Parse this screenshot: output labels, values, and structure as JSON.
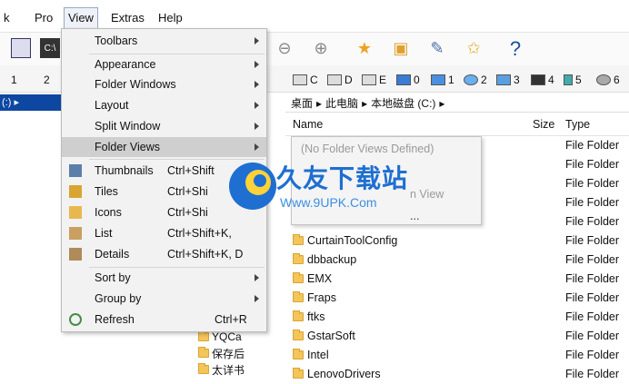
{
  "menubar": {
    "items": [
      "k",
      "Pro",
      "View",
      "Extras",
      "Help"
    ]
  },
  "drives": [
    "1",
    "2",
    "C",
    "D",
    "E",
    "0",
    "1",
    "2",
    "3",
    "4",
    "5",
    "6"
  ],
  "left_pane": {
    "selected_label": "(:) ▸"
  },
  "addressbar": {
    "path": [
      "桌面",
      "此电脑",
      "本地磁盘 (C:)"
    ]
  },
  "columns": {
    "name": "Name",
    "size": "Size",
    "type": "Type"
  },
  "files": [
    {
      "name": "",
      "type": "File Folder"
    },
    {
      "name": "",
      "type": "File Folder"
    },
    {
      "name": "",
      "type": "File Folder"
    },
    {
      "name": "",
      "type": "File Folder"
    },
    {
      "name": "",
      "type": "File Folder"
    },
    {
      "name": "CurtainToolConfig",
      "type": "File Folder"
    },
    {
      "name": "dbbackup",
      "type": "File Folder"
    },
    {
      "name": "EMX",
      "type": "File Folder"
    },
    {
      "name": "Fraps",
      "type": "File Folder"
    },
    {
      "name": "ftks",
      "type": "File Folder"
    },
    {
      "name": "GstarSoft",
      "type": "File Folder"
    },
    {
      "name": "Intel",
      "type": "File Folder"
    },
    {
      "name": "LenovoDrivers",
      "type": "File Folder"
    }
  ],
  "tree": [
    "YQCa",
    "保存后",
    "太详书"
  ],
  "view_menu": {
    "toolbars": "Toolbars",
    "appearance": "Appearance",
    "folder_windows": "Folder Windows",
    "layout": "Layout",
    "split_window": "Split Window",
    "folder_views": "Folder Views",
    "thumbnails": "Thumbnails",
    "thumbnails_sc": "Ctrl+Shift",
    "tiles": "Tiles",
    "tiles_sc": "Ctrl+Shi",
    "icons": "Icons",
    "icons_sc": "Ctrl+Shi",
    "list": "List",
    "list_sc": "Ctrl+Shift+K, ",
    "details": "Details",
    "details_sc": "Ctrl+Shift+K, D",
    "sort_by": "Sort by",
    "group_by": "Group by",
    "refresh": "Refresh",
    "refresh_sc": "Ctrl+R"
  },
  "submenu": {
    "no_views": "(No Folder Views Defined)",
    "item2": "n View",
    "item3": "..."
  },
  "watermark": {
    "title": "久友下载站",
    "url": "Www.9UPK.Com"
  },
  "colors": {
    "menu_bg": "#f2f2f2",
    "highlight": "#cfcfcf",
    "selection": "#0d47a1",
    "folder": "#f4c55a"
  }
}
